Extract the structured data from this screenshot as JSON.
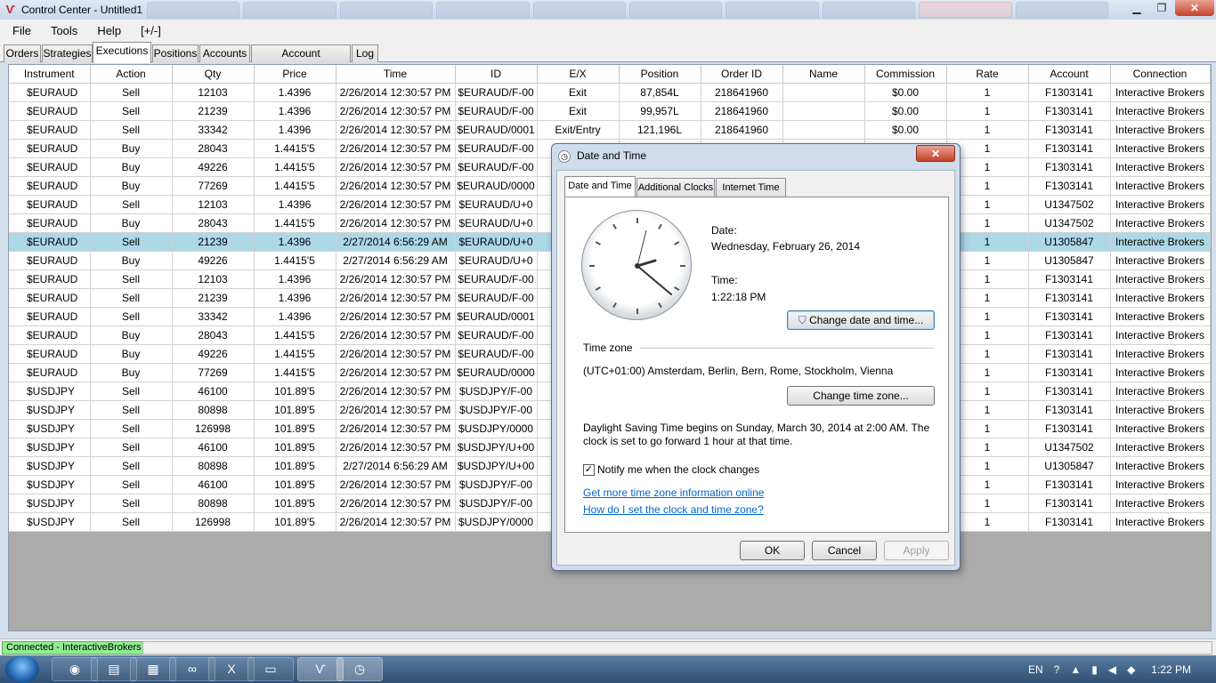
{
  "window": {
    "title": "Control Center - Untitled1"
  },
  "menu": [
    "File",
    "Tools",
    "Help",
    "[+/-]"
  ],
  "tabs": [
    "Orders",
    "Strategies",
    "Executions",
    "Positions",
    "Accounts",
    "Account Performance",
    "Log"
  ],
  "grid": {
    "columns": [
      "Instrument",
      "Action",
      "Qty",
      "Price",
      "Time",
      "ID",
      "E/X",
      "Position",
      "Order ID",
      "Name",
      "Commission",
      "Rate",
      "Account",
      "Connection"
    ],
    "rows": [
      [
        "$EURAUD",
        "Sell",
        "12103",
        "1.4396",
        "2/26/2014 12:30:57 PM",
        "$EURAUD/F-00",
        "Exit",
        "87,854L",
        "218641960",
        "",
        "$0.00",
        "1",
        "F1303141",
        "Interactive Brokers"
      ],
      [
        "$EURAUD",
        "Sell",
        "21239",
        "1.4396",
        "2/26/2014 12:30:57 PM",
        "$EURAUD/F-00",
        "Exit",
        "99,957L",
        "218641960",
        "",
        "$0.00",
        "1",
        "F1303141",
        "Interactive Brokers"
      ],
      [
        "$EURAUD",
        "Sell",
        "33342",
        "1.4396",
        "2/26/2014 12:30:57 PM",
        "$EURAUD/0001",
        "Exit/Entry",
        "121,196L",
        "218641960",
        "",
        "$0.00",
        "1",
        "F1303141",
        "Interactive Brokers"
      ],
      [
        "$EURAUD",
        "Buy",
        "28043",
        "1.4415'5",
        "2/26/2014 12:30:57 PM",
        "$EURAUD/F-00",
        "",
        "",
        "",
        "",
        "",
        "1",
        "F1303141",
        "Interactive Brokers"
      ],
      [
        "$EURAUD",
        "Buy",
        "49226",
        "1.4415'5",
        "2/26/2014 12:30:57 PM",
        "$EURAUD/F-00",
        "",
        "",
        "",
        "",
        "",
        "1",
        "F1303141",
        "Interactive Brokers"
      ],
      [
        "$EURAUD",
        "Buy",
        "77269",
        "1.4415'5",
        "2/26/2014 12:30:57 PM",
        "$EURAUD/0000",
        "",
        "",
        "",
        "",
        "",
        "1",
        "F1303141",
        "Interactive Brokers"
      ],
      [
        "$EURAUD",
        "Sell",
        "12103",
        "1.4396",
        "2/26/2014 12:30:57 PM",
        "$EURAUD/U+0",
        "",
        "",
        "",
        "",
        "",
        "1",
        "U1347502",
        "Interactive Brokers"
      ],
      [
        "$EURAUD",
        "Buy",
        "28043",
        "1.4415'5",
        "2/26/2014 12:30:57 PM",
        "$EURAUD/U+0",
        "",
        "",
        "",
        "",
        "",
        "1",
        "U1347502",
        "Interactive Brokers"
      ],
      [
        "$EURAUD",
        "Sell",
        "21239",
        "1.4396",
        "2/27/2014 6:56:29 AM",
        "$EURAUD/U+0",
        "",
        "",
        "",
        "",
        "",
        "1",
        "U1305847",
        "Interactive Brokers"
      ],
      [
        "$EURAUD",
        "Buy",
        "49226",
        "1.4415'5",
        "2/27/2014 6:56:29 AM",
        "$EURAUD/U+0",
        "",
        "",
        "",
        "",
        "",
        "1",
        "U1305847",
        "Interactive Brokers"
      ],
      [
        "$EURAUD",
        "Sell",
        "12103",
        "1.4396",
        "2/26/2014 12:30:57 PM",
        "$EURAUD/F-00",
        "",
        "",
        "",
        "",
        "",
        "1",
        "F1303141",
        "Interactive Brokers"
      ],
      [
        "$EURAUD",
        "Sell",
        "21239",
        "1.4396",
        "2/26/2014 12:30:57 PM",
        "$EURAUD/F-00",
        "",
        "",
        "",
        "",
        "",
        "1",
        "F1303141",
        "Interactive Brokers"
      ],
      [
        "$EURAUD",
        "Sell",
        "33342",
        "1.4396",
        "2/26/2014 12:30:57 PM",
        "$EURAUD/0001",
        "",
        "",
        "",
        "",
        "",
        "1",
        "F1303141",
        "Interactive Brokers"
      ],
      [
        "$EURAUD",
        "Buy",
        "28043",
        "1.4415'5",
        "2/26/2014 12:30:57 PM",
        "$EURAUD/F-00",
        "",
        "",
        "",
        "",
        "",
        "1",
        "F1303141",
        "Interactive Brokers"
      ],
      [
        "$EURAUD",
        "Buy",
        "49226",
        "1.4415'5",
        "2/26/2014 12:30:57 PM",
        "$EURAUD/F-00",
        "",
        "",
        "",
        "",
        "",
        "1",
        "F1303141",
        "Interactive Brokers"
      ],
      [
        "$EURAUD",
        "Buy",
        "77269",
        "1.4415'5",
        "2/26/2014 12:30:57 PM",
        "$EURAUD/0000",
        "",
        "",
        "",
        "",
        "",
        "1",
        "F1303141",
        "Interactive Brokers"
      ],
      [
        "$USDJPY",
        "Sell",
        "46100",
        "101.89'5",
        "2/26/2014 12:30:57 PM",
        "$USDJPY/F-00",
        "",
        "",
        "",
        "",
        "",
        "1",
        "F1303141",
        "Interactive Brokers"
      ],
      [
        "$USDJPY",
        "Sell",
        "80898",
        "101.89'5",
        "2/26/2014 12:30:57 PM",
        "$USDJPY/F-00",
        "",
        "",
        "",
        "",
        "",
        "1",
        "F1303141",
        "Interactive Brokers"
      ],
      [
        "$USDJPY",
        "Sell",
        "126998",
        "101.89'5",
        "2/26/2014 12:30:57 PM",
        "$USDJPY/0000",
        "",
        "",
        "",
        "",
        "",
        "1",
        "F1303141",
        "Interactive Brokers"
      ],
      [
        "$USDJPY",
        "Sell",
        "46100",
        "101.89'5",
        "2/26/2014 12:30:57 PM",
        "$USDJPY/U+00",
        "",
        "",
        "",
        "",
        "",
        "1",
        "U1347502",
        "Interactive Brokers"
      ],
      [
        "$USDJPY",
        "Sell",
        "80898",
        "101.89'5",
        "2/27/2014 6:56:29 AM",
        "$USDJPY/U+00",
        "",
        "",
        "",
        "",
        "",
        "1",
        "U1305847",
        "Interactive Brokers"
      ],
      [
        "$USDJPY",
        "Sell",
        "46100",
        "101.89'5",
        "2/26/2014 12:30:57 PM",
        "$USDJPY/F-00",
        "",
        "",
        "",
        "",
        "",
        "1",
        "F1303141",
        "Interactive Brokers"
      ],
      [
        "$USDJPY",
        "Sell",
        "80898",
        "101.89'5",
        "2/26/2014 12:30:57 PM",
        "$USDJPY/F-00",
        "",
        "",
        "",
        "",
        "",
        "1",
        "F1303141",
        "Interactive Brokers"
      ],
      [
        "$USDJPY",
        "Sell",
        "126998",
        "101.89'5",
        "2/26/2014 12:30:57 PM",
        "$USDJPY/0000",
        "",
        "",
        "",
        "",
        "",
        "1",
        "F1303141",
        "Interactive Brokers"
      ]
    ],
    "selected_row": 8
  },
  "status": {
    "connection": "Connected - InteractiveBrokers",
    "connection_color": "#90ee90"
  },
  "dialog": {
    "title": "Date and Time",
    "close_label": "✕",
    "tabs": [
      "Date and Time",
      "Additional Clocks",
      "Internet Time"
    ],
    "date_label": "Date:",
    "date_value": "Wednesday, February 26, 2014",
    "time_label": "Time:",
    "time_value": "1:22:18 PM",
    "change_datetime_button": "Change date and time...",
    "timezone_header": "Time zone",
    "timezone_value": "(UTC+01:00) Amsterdam, Berlin, Bern, Rome, Stockholm, Vienna",
    "change_timezone_button": "Change time zone...",
    "dst_line1": "Daylight Saving Time begins on Sunday, March 30, 2014 at 2:00 AM. The",
    "dst_line2": "clock is set to go forward 1 hour at that time.",
    "notify_label": "Notify me when the clock changes",
    "notify_checked": true,
    "link1": "Get more time zone information online",
    "link2": "How do I set the clock and time zone?",
    "ok": "OK",
    "cancel": "Cancel",
    "apply": "Apply"
  },
  "taskbar": {
    "apps": [
      "chrome-icon",
      "explorer-icon",
      "calculator-icon",
      "visual-studio-icon",
      "excel-icon",
      "folder-icon",
      "trading-app-icon",
      "datetime-icon"
    ],
    "tray_lang": "EN",
    "clock": "1:22 PM"
  }
}
